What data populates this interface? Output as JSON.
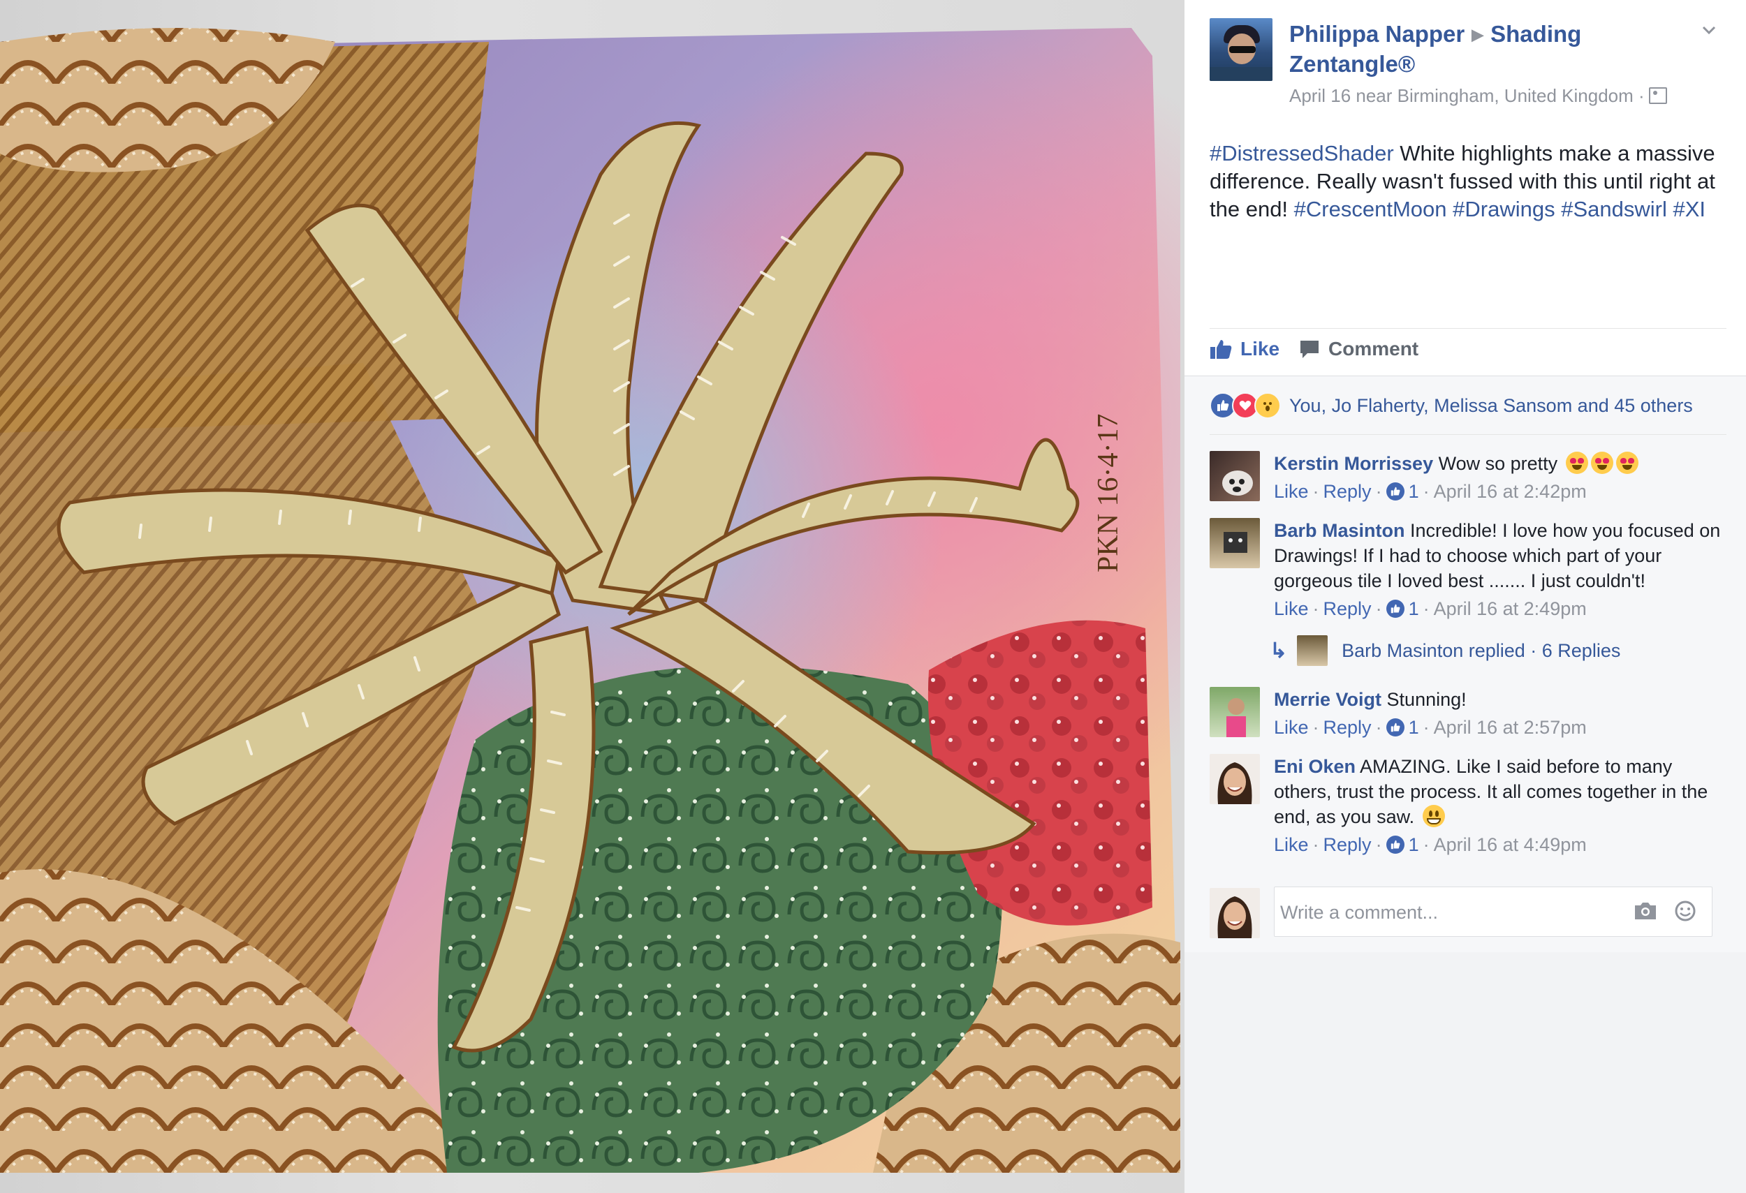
{
  "post": {
    "author": "Philippa Napper",
    "group": "Shading Zentangle®",
    "meta": "April 16 near Birmingham, United Kingdom ·",
    "text": {
      "tag1": "#DistressedShader",
      "body": " White highlights make a massive difference. Really wasn't fussed with this until right at the end! ",
      "tag2": "#CrescentMoon",
      "tag3": "#Drawings",
      "tag4": "#Sandswirl",
      "tag5": "#XI"
    },
    "signature": "PKN 16·4·17"
  },
  "actions": {
    "like": "Like",
    "comment": "Comment"
  },
  "reactions": {
    "summary": "You, Jo Flaherty, Melissa Sansom and 45 others"
  },
  "comments": [
    {
      "name": "Kerstin Morrissey",
      "text": "Wow so pretty",
      "like": "Like",
      "reply": "Reply",
      "count": "1",
      "time": "April 16 at 2:42pm"
    },
    {
      "name": "Barb Masinton",
      "text": "Incredible! I love how you focused on Drawings! If I had to choose which part of your gorgeous tile I loved best ....... I just couldn't!",
      "like": "Like",
      "reply": "Reply",
      "count": "1",
      "time": "April 16 at 2:49pm"
    },
    {
      "name": "Merrie Voigt",
      "text": "Stunning!",
      "like": "Like",
      "reply": "Reply",
      "count": "1",
      "time": "April 16 at 2:57pm"
    },
    {
      "name": "Eni Oken",
      "text": "AMAZING. Like I said before to many others, trust the process. It all comes together in the end, as you saw.",
      "like": "Like",
      "reply": "Reply",
      "count": "1",
      "time": "April 16 at 4:49pm"
    }
  ],
  "replies": {
    "text": "Barb Masinton replied · 6 Replies"
  },
  "composer": {
    "placeholder": "Write a comment..."
  },
  "colors": {
    "link": "#365899",
    "like_blue": "#4267b2",
    "meta_grey": "#90949c",
    "panel_bg": "#f6f7f9"
  }
}
